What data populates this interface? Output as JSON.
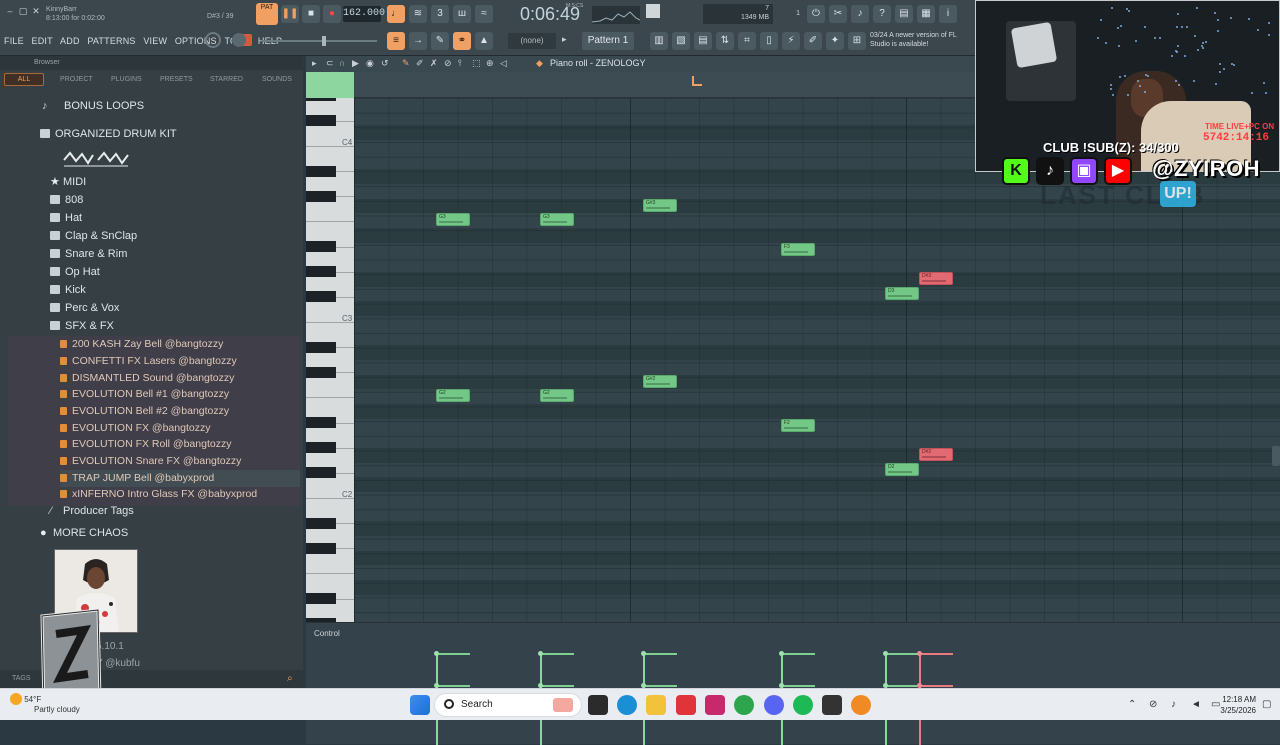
{
  "topbar": {
    "song_name": "KinnyBarr",
    "song_time": "8:13:00 for 0:02:00",
    "note_info": "D#3 / 39",
    "pat_label": "PAT",
    "bpm": "162.000",
    "time": "0:06:49",
    "time_small": "M:S:CS",
    "memory": "1349 MB",
    "cpu_a": "7",
    "cpu_b": "1",
    "menu": [
      "FILE",
      "EDIT",
      "ADD",
      "PATTERNS",
      "VIEW",
      "OPTIONS",
      "TOOLS",
      "HELP"
    ],
    "none_label": "(none)",
    "pattern_label": "Pattern 1",
    "notice_date": "03/24",
    "notice_text": "A newer version of FL Studio is available!"
  },
  "browser": {
    "title": "Browser",
    "tabs": [
      "ALL",
      "PROJECT",
      "PLUGINS",
      "PRESETS",
      "STARRED",
      "SOUNDS"
    ],
    "items": [
      {
        "label": "BONUS LOOPS",
        "kind": "music"
      },
      {
        "label": "ORGANIZED DRUM KIT",
        "kind": "folder"
      },
      {
        "label": "MIDI",
        "kind": "star"
      },
      {
        "label": "808",
        "kind": "folder"
      },
      {
        "label": "Hat",
        "kind": "folder"
      },
      {
        "label": "Clap & SnClap",
        "kind": "folder"
      },
      {
        "label": "Snare & Rim",
        "kind": "folder"
      },
      {
        "label": "Op Hat",
        "kind": "folder"
      },
      {
        "label": "Kick",
        "kind": "folder"
      },
      {
        "label": "Perc & Vox",
        "kind": "folder"
      },
      {
        "label": "SFX & FX",
        "kind": "folder"
      }
    ],
    "files": [
      "200 KASH Zay Bell @bangtozzy",
      "CONFETTI FX Lasers @bangtozzy",
      "DISMANTLED Sound @bangtozzy",
      "EVOLUTION Bell #1 @bangtozzy",
      "EVOLUTION Bell #2 @bangtozzy",
      "EVOLUTION FX @bangtozzy",
      "EVOLUTION FX Roll @bangtozzy",
      "EVOLUTION Snare FX @bangtozzy",
      "TRAP JUMP Bell @babyxprod",
      "xINFERNO Intro Glass FX @babyxprod"
    ],
    "producer_tags": "Producer Tags",
    "more_chaos": "MORE CHAOS",
    "partial_1": "5.10.1",
    "partial_2": "Y @kubfu",
    "tags_label": "TAGS"
  },
  "pianoroll": {
    "title": "Piano roll - ZENOLOGY",
    "control_label": "Control",
    "key_labels": [
      "C4",
      "C3",
      "C2"
    ],
    "notes": [
      {
        "label": "G3",
        "bar": 1,
        "color": "green"
      },
      {
        "label": "G3",
        "bar": 2,
        "color": "green"
      },
      {
        "label": "G#3",
        "bar": 3,
        "color": "green"
      },
      {
        "label": "F3",
        "bar": 4,
        "color": "green"
      },
      {
        "label": "D3",
        "bar": 5,
        "color": "green"
      },
      {
        "label": "D#3",
        "bar": 5.5,
        "color": "red"
      },
      {
        "label": "G2",
        "bar": 1,
        "color": "green"
      },
      {
        "label": "G2",
        "bar": 2,
        "color": "green"
      },
      {
        "label": "G#2",
        "bar": 3,
        "color": "green"
      },
      {
        "label": "F2",
        "bar": 4,
        "color": "green"
      },
      {
        "label": "D2",
        "bar": 5,
        "color": "green"
      },
      {
        "label": "D#2",
        "bar": 5.5,
        "color": "red"
      }
    ]
  },
  "overlay": {
    "live_label": "TIME LIVE+PC ON",
    "live_value": "5742:14:16",
    "subgoal": "CLUB !SUB(Z): 34/300",
    "handle": "@ZYIROH",
    "last_club": "LAST CLUB",
    "up_badge": "UP!"
  },
  "taskbar": {
    "weather_temp": "54°F",
    "weather_desc": "Partly cloudy",
    "search_placeholder": "Search",
    "time": "12:18 AM",
    "date": "3/25/2026"
  },
  "colors": {
    "accent_orange": "#f0a062",
    "note_green": "#74c887",
    "note_red": "#e26a72",
    "grid_bg": "#33444b"
  }
}
